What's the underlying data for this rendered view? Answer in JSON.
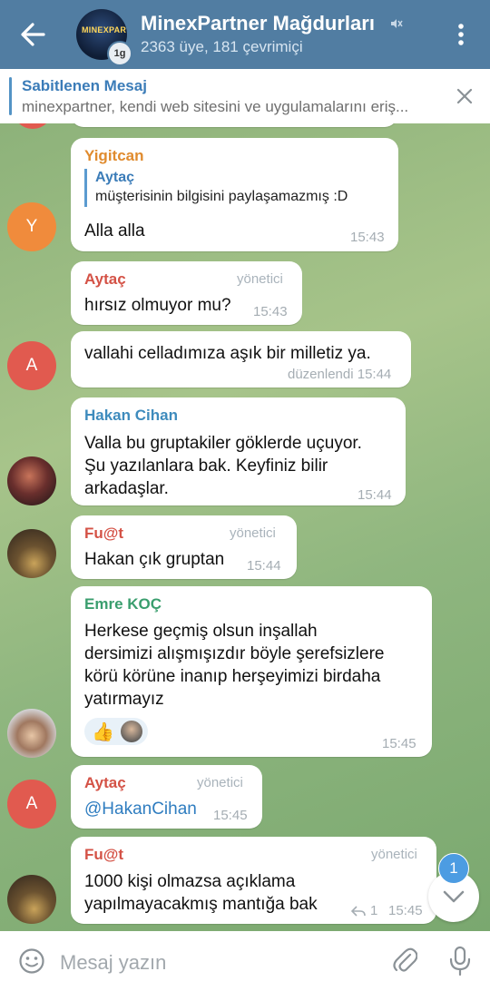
{
  "header": {
    "title": "MinexPartner Mağdurları",
    "subtitle": "2363 üye, 181 çevrimiçi",
    "avatar_logo": "MINEXPARTNER",
    "avatar_badge": "1g",
    "color": "#517da2"
  },
  "pinned": {
    "title": "Sabitlenen Mesaj",
    "text": "minexpartner, kendi web sitesini ve uygulamalarını eriş..."
  },
  "messages": [
    {
      "sender": "Yigitcan",
      "sender_color": "#e08b2e",
      "reply_name": "Aytaç",
      "reply_text": "müşterisinin bilgisini paylaşamazmış :D",
      "text": "Alla alla",
      "time": "15:43",
      "avatar": "Y"
    },
    {
      "sender": "Aytaç",
      "sender_color": "#d45246",
      "role": "yönetici",
      "text": "hırsız olmuyor mu?",
      "time": "15:43"
    },
    {
      "text": "vallahi celladımıza aşık bir milletiz ya.",
      "time": "düzenlendi 15:44",
      "avatar": "A"
    },
    {
      "sender": "Hakan Cihan",
      "sender_color": "#3e8bbd",
      "lines": [
        "Valla bu gruptakiler göklerde uçuyor.",
        "Şu yazılanlara bak. Keyfiniz bilir",
        "arkadaşlar."
      ],
      "time": "15:44"
    },
    {
      "sender": "Fu@t",
      "sender_color": "#d45246",
      "role": "yönetici",
      "text": "Hakan çık gruptan",
      "time": "15:44"
    },
    {
      "sender": "Emre KOÇ",
      "sender_color": "#3a9e6e",
      "lines": [
        "Herkese geçmiş olsun inşallah",
        "dersimizi alışmışızdır böyle şerefsizlere",
        "körü körüne inanıp herşeyimizi birdaha",
        "yatırmayız"
      ],
      "reaction": "👍",
      "time": "15:45"
    },
    {
      "sender": "Aytaç",
      "sender_color": "#d45246",
      "role": "yönetici",
      "text": "@HakanCihan",
      "time": "15:45",
      "avatar": "A"
    },
    {
      "sender": "Fu@t",
      "sender_color": "#d45246",
      "role": "yönetici",
      "lines": [
        "1000 kişi olmazsa açıklama",
        "yapılmayacakmış mantığa bak"
      ],
      "reply_count": "1",
      "time": "15:45"
    }
  ],
  "unread_count": "1",
  "input": {
    "placeholder": "Mesaj yazın"
  }
}
